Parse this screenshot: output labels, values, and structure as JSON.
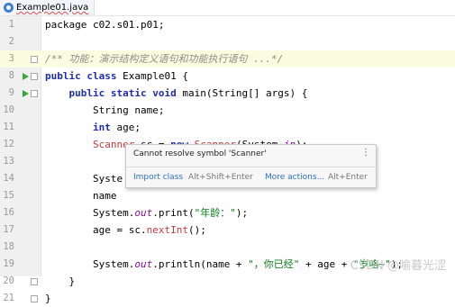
{
  "tab": {
    "label": "Example01.java"
  },
  "lines": [
    {
      "n": "1",
      "segs": [
        {
          "t": "package c02.s01.p01;",
          "c": ""
        }
      ]
    },
    {
      "n": "2",
      "segs": []
    },
    {
      "n": "3",
      "segs": [
        {
          "t": "/** 功能：演示结构定义语句和功能执行语句 ...*/",
          "c": "cm"
        }
      ]
    },
    {
      "n": "8",
      "segs": [
        {
          "t": "public class ",
          "c": "kw"
        },
        {
          "t": "Example01 {",
          "c": ""
        }
      ]
    },
    {
      "n": "9",
      "segs": [
        {
          "t": "    public static void ",
          "c": "kw"
        },
        {
          "t": "main(String[] args) {",
          "c": ""
        }
      ]
    },
    {
      "n": "10",
      "segs": [
        {
          "t": "        String name;",
          "c": ""
        }
      ]
    },
    {
      "n": "11",
      "segs": [
        {
          "t": "        ",
          "c": ""
        },
        {
          "t": "int ",
          "c": "kw"
        },
        {
          "t": "age;",
          "c": ""
        }
      ]
    },
    {
      "n": "12",
      "segs": [
        {
          "t": "        ",
          "c": ""
        },
        {
          "t": "Scanner",
          "c": "err"
        },
        {
          "t": " sc = ",
          "c": ""
        },
        {
          "t": "new ",
          "c": "kw"
        },
        {
          "t": "Scanner",
          "c": "err"
        },
        {
          "t": "(System.",
          "c": ""
        },
        {
          "t": "in",
          "c": "stat"
        },
        {
          "t": ");",
          "c": ""
        }
      ]
    },
    {
      "n": "13",
      "segs": []
    },
    {
      "n": "14",
      "segs": [
        {
          "t": "        Syste",
          "c": ""
        }
      ]
    },
    {
      "n": "15",
      "segs": [
        {
          "t": "        name",
          "c": ""
        }
      ]
    },
    {
      "n": "16",
      "segs": [
        {
          "t": "        System.",
          "c": ""
        },
        {
          "t": "out",
          "c": "stat"
        },
        {
          "t": ".print(",
          "c": ""
        },
        {
          "t": "\"年龄：\"",
          "c": "str"
        },
        {
          "t": ");",
          "c": ""
        }
      ]
    },
    {
      "n": "17",
      "segs": [
        {
          "t": "        age = sc.",
          "c": ""
        },
        {
          "t": "nextInt",
          "c": "err"
        },
        {
          "t": "();",
          "c": ""
        }
      ]
    },
    {
      "n": "18",
      "segs": []
    },
    {
      "n": "19",
      "segs": [
        {
          "t": "        System.",
          "c": ""
        },
        {
          "t": "out",
          "c": "stat"
        },
        {
          "t": ".println(name + ",
          "c": ""
        },
        {
          "t": "\"，你已经\"",
          "c": "str"
        },
        {
          "t": " + age + ",
          "c": ""
        },
        {
          "t": "\"岁咯~\"",
          "c": "str"
        },
        {
          "t": ");",
          "c": ""
        }
      ]
    },
    {
      "n": "20",
      "segs": [
        {
          "t": "    }",
          "c": ""
        }
      ]
    },
    {
      "n": "21",
      "segs": [
        {
          "t": "}",
          "c": ""
        }
      ]
    }
  ],
  "popup": {
    "message": "Cannot resolve symbol 'Scanner'",
    "menu_glyph": "⋮",
    "action1_label": "Import class",
    "action1_key": "Alt+Shift+Enter",
    "action2_label": "More actions...",
    "action2_key": "Alt+Enter"
  },
  "watermark": "CSDN @喻暮光涩",
  "colors": {
    "keyword": "#1e2dad",
    "string": "#067d17",
    "comment": "#8c8c8c",
    "error": "#c33b3b",
    "run": "#3aa63a"
  }
}
